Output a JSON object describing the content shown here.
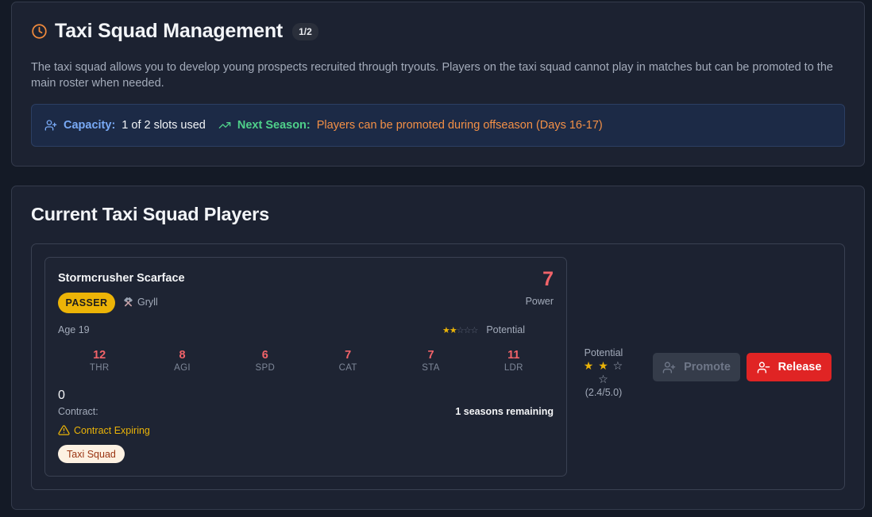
{
  "header": {
    "title": "Taxi Squad Management",
    "count_badge": "1/2",
    "description": "The taxi squad allows you to develop young prospects recruited through tryouts. Players on the taxi squad cannot play in matches but can be promoted to the main roster when needed.",
    "capacity_label": "Capacity:",
    "capacity_value": "1 of 2 slots used",
    "next_season_label": "Next Season:",
    "next_season_value": "Players can be promoted during offseason (Days 16-17)"
  },
  "section": {
    "title": "Current Taxi Squad Players"
  },
  "player": {
    "name": "Stormcrusher Scarface",
    "power_value": "7",
    "power_label": "Power",
    "position": "PASSER",
    "race": "Gryll",
    "age": "Age 19",
    "potential_label": "Potential",
    "potential_stars_small": "★★☆☆☆",
    "stats": [
      {
        "value": "12",
        "label": "THR"
      },
      {
        "value": "8",
        "label": "AGI"
      },
      {
        "value": "6",
        "label": "SPD"
      },
      {
        "value": "7",
        "label": "CAT"
      },
      {
        "value": "7",
        "label": "STA"
      },
      {
        "value": "11",
        "label": "LDR"
      }
    ],
    "contract_value": "0",
    "contract_label": "Contract:",
    "seasons_remaining": "1 seasons remaining",
    "contract_warning": "Contract Expiring",
    "status_badge": "Taxi Squad",
    "potential_rating": 2.4,
    "potential_max": 5.0,
    "potential_col_label": "Potential",
    "potential_col_filled": "★ ★",
    "potential_col_empty": " ☆ ☆",
    "potential_col_value": "(2.4/5.0)"
  },
  "actions": {
    "promote_label": "Promote",
    "release_label": "Release"
  },
  "colors": {
    "background": "#141a26",
    "panel": "#1c2231",
    "accent_orange": "#f39046",
    "accent_blue": "#79aaf6",
    "accent_green": "#4fd08a",
    "stat_red": "#f26369",
    "position_yellow": "#ecb407",
    "release_red": "#e02424",
    "warning_yellow": "#eab308"
  },
  "icons": {
    "title": "clock-icon",
    "capacity": "user-plus-icon",
    "next_season": "trending-up-icon",
    "race": "crossed-hammers-icon",
    "warning": "alert-triangle-icon",
    "promote": "user-plus-icon",
    "release": "user-minus-icon"
  }
}
